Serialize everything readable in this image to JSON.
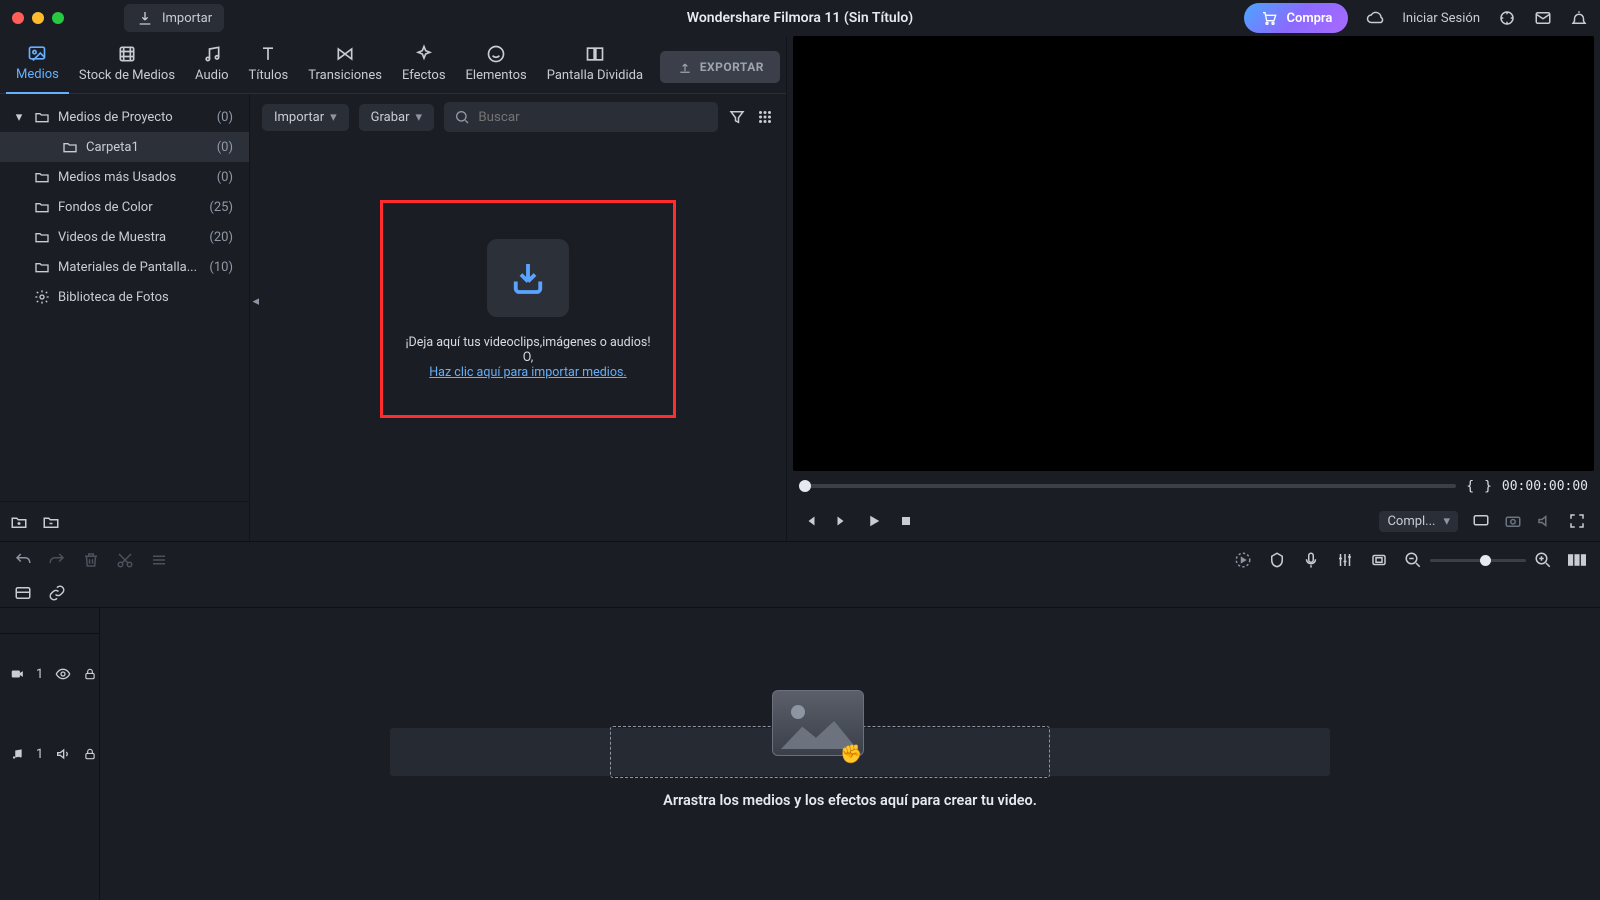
{
  "titlebar": {
    "app_title": "Wondershare Filmora 11 (Sin Título)",
    "import_label": "Importar",
    "compra_label": "Compra",
    "login_label": "Iniciar Sesión"
  },
  "tabs": {
    "items": [
      {
        "label": "Medios",
        "icon": "photo"
      },
      {
        "label": "Stock de Medios",
        "icon": "film"
      },
      {
        "label": "Audio",
        "icon": "music"
      },
      {
        "label": "Títulos",
        "icon": "title"
      },
      {
        "label": "Transiciones",
        "icon": "transition"
      },
      {
        "label": "Efectos",
        "icon": "sparkle"
      },
      {
        "label": "Elementos",
        "icon": "smile"
      },
      {
        "label": "Pantalla Dividida",
        "icon": "split"
      }
    ],
    "export_label": "EXPORTAR"
  },
  "sidebar": {
    "rows": [
      {
        "label": "Medios de Proyecto",
        "count": "(0)",
        "chev": "▾",
        "depth": 0
      },
      {
        "label": "Carpeta1",
        "count": "(0)",
        "chev": "",
        "depth": 1,
        "selected": true
      },
      {
        "label": "Medios más Usados",
        "count": "(0)",
        "chev": "",
        "depth": 0
      },
      {
        "label": "Fondos de Color",
        "count": "(25)",
        "chev": "",
        "depth": 0
      },
      {
        "label": "Videos de Muestra",
        "count": "(20)",
        "chev": "",
        "depth": 0
      },
      {
        "label": "Materiales de Pantalla...",
        "count": "(10)",
        "chev": "",
        "depth": 0
      },
      {
        "label": "Biblioteca de Fotos",
        "count": "",
        "chev": "",
        "depth": 0,
        "alticon": true
      }
    ]
  },
  "content_top": {
    "importar": "Importar",
    "grabar": "Grabar",
    "search_placeholder": "Buscar"
  },
  "dropzone": {
    "line1": "¡Deja aquí tus videoclips,imágenes o audios! O,",
    "link": "Haz clic aquí para importar medios."
  },
  "preview": {
    "timecode": "00:00:00:00",
    "mark_in": "{",
    "mark_out": "}",
    "fit_label": "Compl..."
  },
  "timeline": {
    "video_track_label": "1",
    "audio_track_label": "1",
    "hint": "Arrastra los medios y los efectos aquí para crear tu video."
  }
}
